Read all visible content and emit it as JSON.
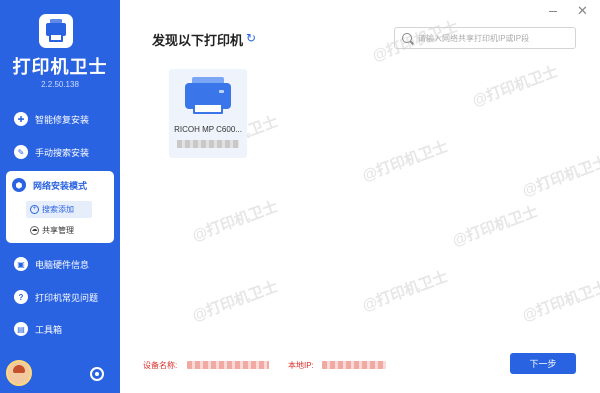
{
  "app": {
    "title": "打印机卫士",
    "version": "2.2.50.138"
  },
  "sidebar": {
    "items": [
      {
        "label": "智能修复安装",
        "icon": "wrench-icon"
      },
      {
        "label": "手动搜索安装",
        "icon": "search-tool-icon"
      },
      {
        "label": "网络安装模式",
        "icon": "network-icon"
      },
      {
        "label": "电脑硬件信息",
        "icon": "hardware-icon"
      },
      {
        "label": "打印机常见问题",
        "icon": "printer-help-icon"
      },
      {
        "label": "工具箱",
        "icon": "toolbox-icon"
      }
    ],
    "sub_items": [
      {
        "label": "搜索添加",
        "icon": "search-add-icon"
      },
      {
        "label": "共享管理",
        "icon": "cloud-icon"
      }
    ]
  },
  "main": {
    "heading": "发现以下打印机",
    "search_placeholder": "请输入网络共享打印机IP或IP段",
    "printer": {
      "name": "RICOH MP C600..."
    },
    "watermark": "@打印机卫士"
  },
  "footer": {
    "device_label": "设备名称:",
    "ip_label": "本地IP:",
    "next_label": "下一步"
  },
  "colors": {
    "primary": "#2a63e2",
    "accent_red": "#d9302c"
  }
}
